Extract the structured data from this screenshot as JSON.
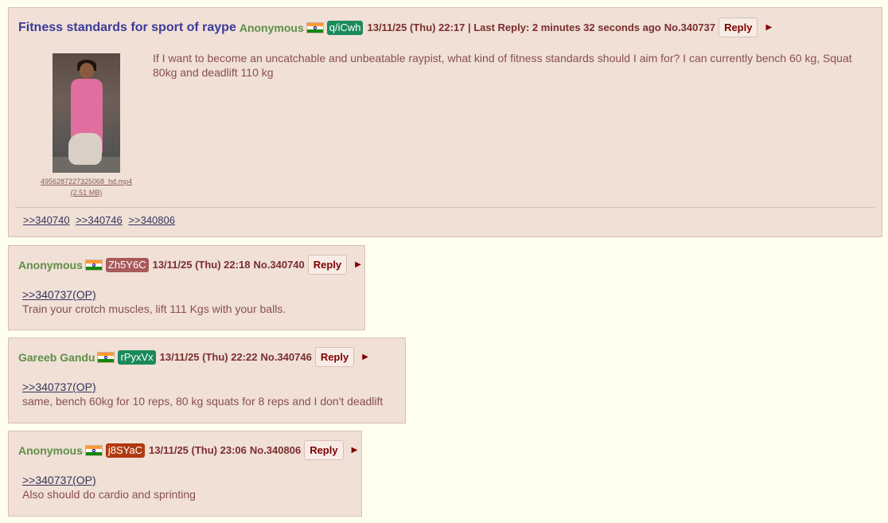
{
  "op": {
    "subject": "Fitness standards for sport of raype",
    "name": "Anonymous",
    "id": "q/iCwh",
    "id_color": "#1a8a5a",
    "datetime": "13/11/25 (Thu) 22:17",
    "last_reply": "| Last Reply: 2 minutes 32 seconds ago",
    "number": "No.340737",
    "reply_label": "Reply",
    "arrow": "▶",
    "file_name": "4956287227325068_hd.mp4",
    "file_size": "(2.51 MB)",
    "text": "If I want to become an uncatchable and unbeatable raypist, what kind of fitness standards should I aim for? I can currently bench 60 kg, Squat 80kg and deadlift 110 kg",
    "backlinks": [
      ">>340740",
      ">>340746",
      ">>340806"
    ]
  },
  "replies": [
    {
      "name": "Anonymous",
      "id": "Zh5Y6C",
      "id_color": "#a85a5a",
      "datetime": "13/11/25 (Thu) 22:18",
      "number": "No.340740",
      "reply_label": "Reply",
      "arrow": "▶",
      "quote": ">>340737(OP)",
      "text": "Train your crotch muscles, lift 111 Kgs with your balls."
    },
    {
      "name": "Gareeb Gandu",
      "id": "rPyxVx",
      "id_color": "#1a8a5a",
      "datetime": "13/11/25 (Thu) 22:22",
      "number": "No.340746",
      "reply_label": "Reply",
      "arrow": "▶",
      "quote": ">>340737(OP)",
      "text": "same, bench 60kg for 10 reps, 80 kg squats for 8 reps and I don't deadlift"
    },
    {
      "name": "Anonymous",
      "id": "j8SYaC",
      "id_color": "#b03a10",
      "datetime": "13/11/25 (Thu) 23:06",
      "number": "No.340806",
      "reply_label": "Reply",
      "arrow": "▶",
      "quote": ">>340737(OP)",
      "text": "Also should do cardio and sprinting"
    }
  ]
}
